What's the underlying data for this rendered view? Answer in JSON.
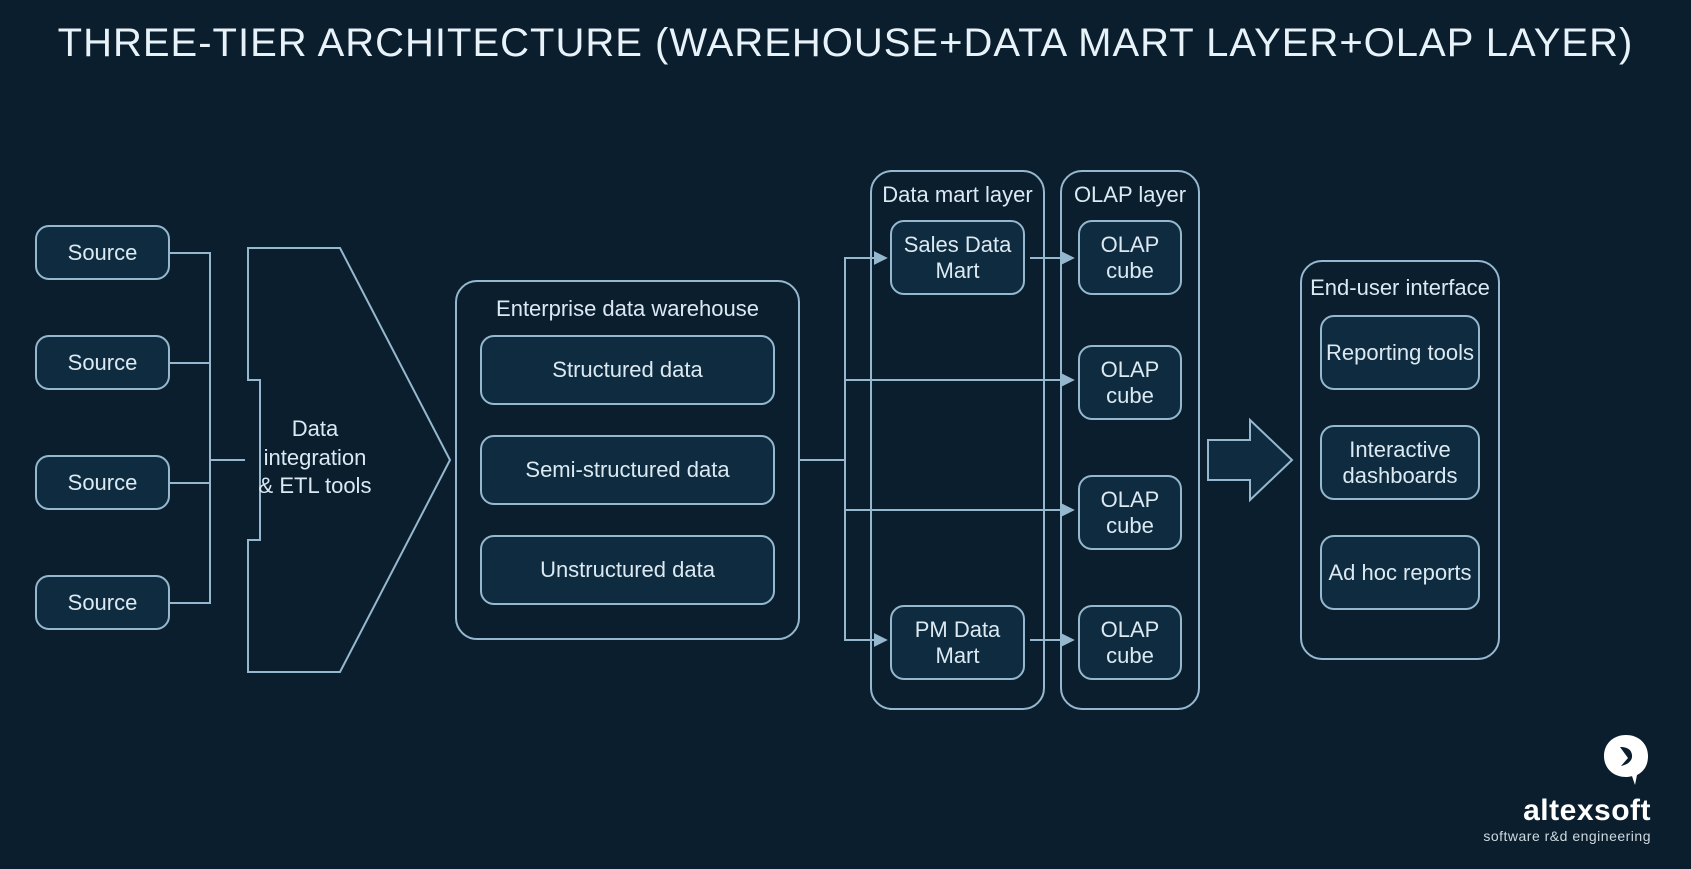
{
  "title": "THREE-TIER ARCHITECTURE (WAREHOUSE+DATA MART LAYER+OLAP LAYER)",
  "sources": {
    "s1": "Source",
    "s2": "Source",
    "s3": "Source",
    "s4": "Source"
  },
  "etl_label": "Data\nintegration\n& ETL tools",
  "etl_label_l1": "Data",
  "etl_label_l2": "integration",
  "etl_label_l3": "& ETL tools",
  "warehouse": {
    "title": "Enterprise data warehouse",
    "items": {
      "structured": "Structured data",
      "semi": "Semi-structured data",
      "unstructured": "Unstructured data"
    }
  },
  "datamart": {
    "title": "Data mart layer",
    "sales": "Sales Data Mart",
    "pm": "PM Data Mart"
  },
  "olap": {
    "title": "OLAP layer",
    "cube1": "OLAP cube",
    "cube2": "OLAP cube",
    "cube3": "OLAP cube",
    "cube4": "OLAP cube"
  },
  "enduser": {
    "title": "End-user interface",
    "reporting": "Reporting tools",
    "dashboards": "Interactive dashboards",
    "adhoc": "Ad hoc reports"
  },
  "brand": {
    "name": "altexsoft",
    "tagline": "software r&d engineering"
  }
}
